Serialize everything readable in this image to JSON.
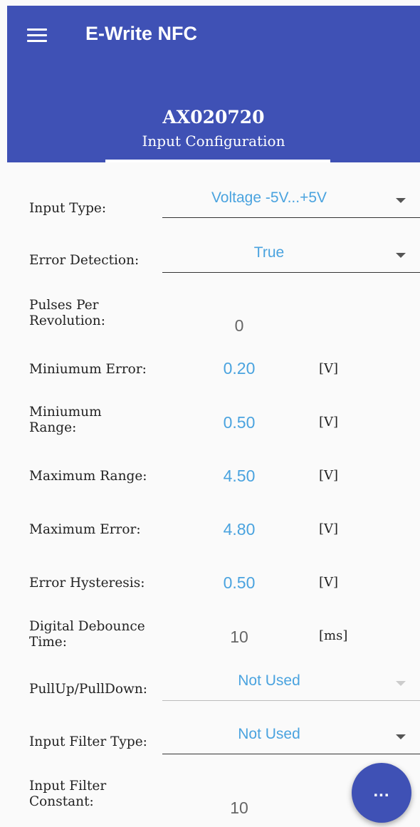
{
  "appbar": {
    "title": "E-Write NFC",
    "device_id": "AX020720",
    "tab_label": "Input Configuration",
    "color": "#3f51b5"
  },
  "icons": {
    "menu": "hamburger-menu-icon",
    "fab": "more-horizontal-icon"
  },
  "fields": {
    "input_type": {
      "label": "Input Type:",
      "value": "Voltage -5V...+5V"
    },
    "error_detection": {
      "label": "Error Detection:",
      "value": "True"
    },
    "pulses_per_revolution": {
      "label_line1": "Pulses Per",
      "label_line2": "Revolution:",
      "value": "0"
    },
    "minimum_error": {
      "label": "Miniumum Error:",
      "value": "0.20",
      "unit": "[V]"
    },
    "minimum_range": {
      "label_line1": "Miniumum",
      "label_line2": "Range:",
      "value": "0.50",
      "unit": "[V]"
    },
    "maximum_range": {
      "label": "Maximum Range:",
      "value": "4.50",
      "unit": "[V]"
    },
    "maximum_error": {
      "label": "Maximum Error:",
      "value": "4.80",
      "unit": "[V]"
    },
    "error_hysteresis": {
      "label": "Error Hysteresis:",
      "value": "0.50",
      "unit": "[V]"
    },
    "digital_debounce_time": {
      "label_line1": "Digital Debounce",
      "label_line2": "Time:",
      "value": "10",
      "unit": "[ms]"
    },
    "pullup_pulldown": {
      "label": "PullUp/PullDown:",
      "value": "Not Used"
    },
    "input_filter_type": {
      "label": "Input Filter Type:",
      "value": "Not Used"
    },
    "input_filter_constant": {
      "label_line1": "Input Filter",
      "label_line2": "Constant:",
      "value": "10"
    }
  },
  "fab": {
    "label": "..."
  },
  "colors": {
    "accent_value": "#4aa3df",
    "inactive_value": "#666666"
  }
}
